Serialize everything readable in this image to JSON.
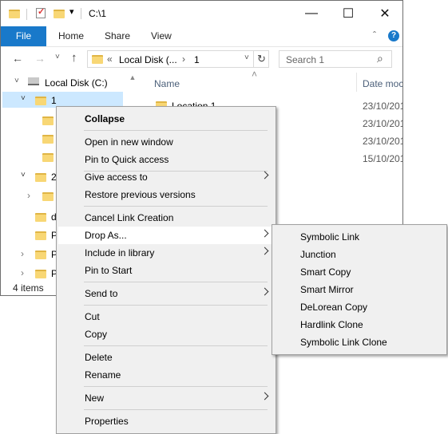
{
  "window": {
    "title": "C:\\1",
    "minimize": "—",
    "maximize": "☐",
    "close": "✕"
  },
  "ribbon": {
    "tabs": [
      "File",
      "Home",
      "Share",
      "View"
    ],
    "collapse_glyph": "ˆ",
    "help_glyph": "?"
  },
  "nav": {
    "back": "←",
    "forward": "→",
    "recent": "˅",
    "up": "↑",
    "address_prefix": "«",
    "address_parts": [
      "Local Disk (...",
      "1"
    ],
    "address_sep": "›",
    "address_dropdown": "˅",
    "refresh": "↻",
    "search_placeholder": "Search 1",
    "search_icon": "⌕"
  },
  "tree": {
    "items": [
      {
        "label": "Local Disk (C:)",
        "icon": "drive-icon"
      },
      {
        "label": "1",
        "icon": "folder-icon",
        "selected": true
      },
      {
        "label": "",
        "icon": "folder-icon"
      },
      {
        "label": "",
        "icon": "folder-icon"
      },
      {
        "label": "",
        "icon": "folder-icon"
      },
      {
        "label": "2",
        "icon": "folder-icon"
      },
      {
        "label": "",
        "icon": "link-folder-icon"
      },
      {
        "label": "d",
        "icon": "folder-icon"
      },
      {
        "label": "P",
        "icon": "folder-icon"
      },
      {
        "label": "P",
        "icon": "folder-icon"
      },
      {
        "label": "P",
        "icon": "folder-icon"
      }
    ],
    "expanded_glyph": "˅",
    "collapsed_glyph": "›"
  },
  "content": {
    "col_name": "Name",
    "col_date": "Date moc",
    "sort_glyph": "˄",
    "rows": [
      {
        "name": "Location 1",
        "date": "23/10/201"
      },
      {
        "name": "",
        "date": "23/10/201"
      },
      {
        "name": "",
        "date": "23/10/201"
      },
      {
        "name": "",
        "date": "15/10/201"
      }
    ]
  },
  "status": {
    "items": "4 items"
  },
  "context_menu": {
    "items": [
      {
        "label": "Collapse",
        "bold": true
      },
      {
        "label": "Open in new window"
      },
      {
        "label": "Pin to Quick access"
      },
      {
        "label": "Give access to",
        "submenu": true
      },
      {
        "label": "Restore previous versions"
      },
      {
        "label": "Cancel Link Creation"
      },
      {
        "label": "Drop As...",
        "submenu": true,
        "highlighted": true
      },
      {
        "label": "Include in library",
        "submenu": true
      },
      {
        "label": "Pin to Start"
      },
      {
        "label": "Send to",
        "submenu": true
      },
      {
        "label": "Cut"
      },
      {
        "label": "Copy"
      },
      {
        "label": "Delete"
      },
      {
        "label": "Rename"
      },
      {
        "label": "New",
        "submenu": true
      },
      {
        "label": "Properties"
      }
    ]
  },
  "drop_as_menu": {
    "items": [
      "Symbolic Link",
      "Junction",
      "Smart Copy",
      "Smart Mirror",
      "DeLorean Copy",
      "Hardlink Clone",
      "Symbolic Link Clone"
    ]
  },
  "colors": {
    "file_tab": "#1979ca",
    "selection": "#cce8ff",
    "folder": "#f8d775"
  }
}
